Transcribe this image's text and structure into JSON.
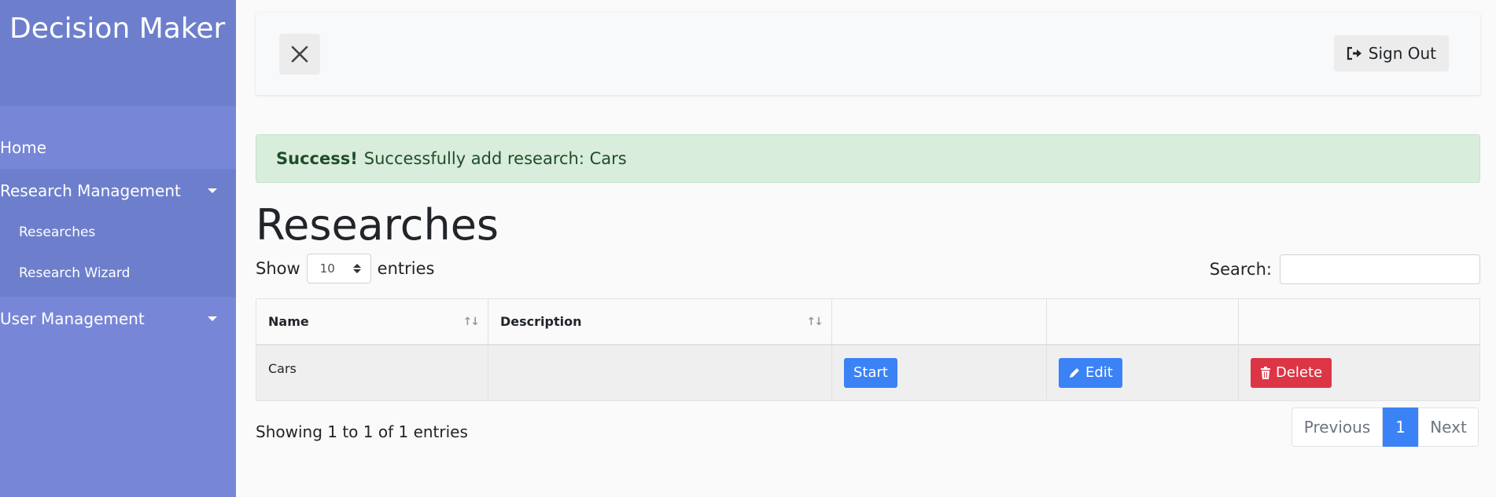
{
  "sidebar": {
    "brand": "Decision Maker",
    "items": [
      {
        "label": "Home"
      },
      {
        "label": "Research Management"
      },
      {
        "label": "User Management"
      }
    ],
    "research_submenu": [
      {
        "label": "Researches"
      },
      {
        "label": "Research Wizard"
      }
    ]
  },
  "topbar": {
    "signout_label": "Sign Out"
  },
  "alert": {
    "strong": "Success!",
    "message": "Successfully add research: Cars"
  },
  "page_title": "Researches",
  "table_controls": {
    "show_label": "Show",
    "entries_label": "entries",
    "length_value": "10",
    "search_label": "Search:",
    "search_value": ""
  },
  "table": {
    "headers": [
      "Name",
      "Description",
      "",
      "",
      ""
    ],
    "rows": [
      {
        "name": "Cars",
        "description": "",
        "start_label": "Start",
        "edit_label": "Edit",
        "delete_label": "Delete"
      }
    ]
  },
  "footer": {
    "info": "Showing 1 to 1 of 1 entries",
    "prev_label": "Previous",
    "current_page": "1",
    "next_label": "Next"
  },
  "colors": {
    "sidebar": "#7886d7",
    "sidebar_dark": "#6d7fcc",
    "primary": "#3b82f6",
    "danger": "#dc3545",
    "success_bg": "#d8eddb"
  }
}
